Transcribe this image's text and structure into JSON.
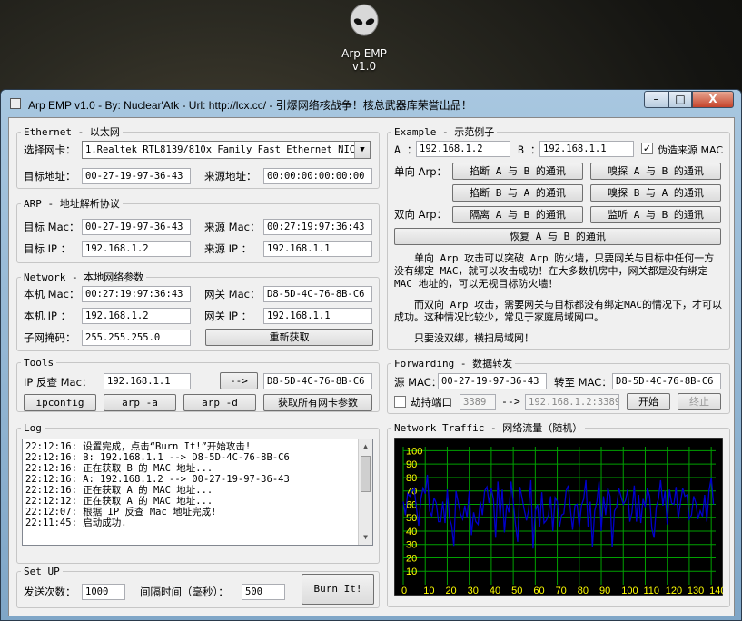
{
  "desktop_icon": {
    "name": "Arp EMP",
    "version": "v1.0"
  },
  "window": {
    "title": "Arp EMP v1.0  -  By: Nuclear'Atk  -  Url: http://lcx.cc/  -  引爆网络核战争！核总武器库荣誉出品！",
    "controls": {
      "minimize": "–",
      "maximize": "□",
      "close": "X"
    }
  },
  "ethernet": {
    "legend": "Ethernet - 以太网",
    "nic_label": "选择网卡：",
    "nic_value": "1.Realtek RTL8139/810x Family Fast Ethernet NIC",
    "target_addr_label": "目标地址：",
    "target_addr": "00-27-19-97-36-43",
    "source_addr_label": "来源地址：",
    "source_addr": "00:00:00:00:00:00"
  },
  "arp": {
    "legend": "ARP - 地址解析协议",
    "target_mac_label": "目标 Mac：",
    "target_mac": "00-27-19-97-36-43",
    "source_mac_label": "来源 Mac：",
    "source_mac": "00:27:19:97:36:43",
    "target_ip_label": "目标 IP ：",
    "target_ip": "192.168.1.2",
    "source_ip_label": "来源 IP ：",
    "source_ip": "192.168.1.1"
  },
  "network": {
    "legend": "Network - 本地网络参数",
    "local_mac_label": "本机 Mac：",
    "local_mac": "00:27:19:97:36:43",
    "gateway_mac_label": "网关 Mac：",
    "gateway_mac": "D8-5D-4C-76-8B-C6",
    "local_ip_label": "本机 IP ：",
    "local_ip": "192.168.1.2",
    "gateway_ip_label": "网关 IP ：",
    "gateway_ip": "192.168.1.1",
    "subnet_label": "子网掩码：",
    "subnet": "255.255.255.0",
    "refresh_button": "重新获取"
  },
  "tools": {
    "legend": "Tools",
    "reverse_label": "IP 反查 Mac：",
    "reverse_ip": "192.168.1.1",
    "arrow_button": "-->",
    "reverse_result": "D8-5D-4C-76-8B-C6",
    "ipconfig_button": "ipconfig",
    "arp_a_button": "arp -a",
    "arp_d_button": "arp -d",
    "all_nic_button": "获取所有网卡参数"
  },
  "log": {
    "legend": "Log",
    "lines": [
      "22:12:16: 设置完成，点击“Burn It!”开始攻击!",
      "22:12:16: B: 192.168.1.1 --> D8-5D-4C-76-8B-C6",
      "22:12:16: 正在获取 B 的 MAC 地址...",
      "22:12:16: A: 192.168.1.2 --> 00-27-19-97-36-43",
      "22:12:16: 正在获取 A 的 MAC 地址...",
      "22:12:12: 正在获取 A 的 MAC 地址...",
      "22:12:07: 根据 IP 反查 Mac 地址完成!",
      "22:11:45: 启动成功."
    ]
  },
  "setup": {
    "legend": "Set UP",
    "count_label": "发送次数：",
    "count": "1000",
    "interval_label": "间隔时间（毫秒）：",
    "interval": "500",
    "burn_button": "Burn It!"
  },
  "example": {
    "legend": "Example - 示范例子",
    "a_label": "A ：",
    "a_value": "192.168.1.2",
    "b_label": "B ：",
    "b_value": "192.168.1.1",
    "spoof_label": "伪造来源 MAC",
    "spoof_checked": "✓",
    "one_way_label": "单向 Arp：",
    "two_way_label": "双向 Arp：",
    "buttons": {
      "cut_a_b": "掐断 A 与 B 的通讯",
      "sniff_a_b": "嗅探 A 与 B 的通讯",
      "cut_b_a": "掐断 B 与 A 的通讯",
      "sniff_b_a": "嗅探 B 与 A 的通讯",
      "isolate": "隔离 A 与 B 的通讯",
      "monitor": "监听 A 与 B 的通讯",
      "restore": "恢复 A 与 B 的通讯"
    },
    "desc": [
      "单向 Arp 攻击可以突破 Arp 防火墙，只要网关与目标中任何一方没有绑定 MAC，就可以攻击成功！在大多数机房中，网关都是没有绑定 MAC 地址的，可以无视目标防火墙！",
      "而双向 Arp 攻击，需要网关与目标都没有绑定MAC的情况下，才可以成功。这种情况比较少，常见于家庭局域网中。",
      "只要没双绑，横扫局域网！"
    ]
  },
  "forwarding": {
    "legend": "Forwarding - 数据转发",
    "src_label": "源 MAC：",
    "src_mac": "00-27-19-97-36-43",
    "to_label": "转至 MAC：",
    "to_mac": "D8-5D-4C-76-8B-C6",
    "hijack_label": "劫持端口",
    "port": "3389",
    "arrow": "-->",
    "dest": "192.168.1.2:3389",
    "start_button": "开始",
    "stop_button": "终止"
  },
  "traffic": {
    "legend": "Network Traffic - 网络流量（随机）",
    "line_color": "#0000cc",
    "grid_color": "#00a000",
    "label_color": "#ffff00"
  },
  "chart_data": {
    "type": "line",
    "x_ticks": [
      "0",
      "10",
      "20",
      "30",
      "40",
      "50",
      "60",
      "70",
      "80",
      "90",
      "100",
      "110",
      "120",
      "130",
      "140"
    ],
    "y_ticks": [
      "100",
      "90",
      "80",
      "70",
      "60",
      "50",
      "40",
      "30",
      "20",
      "10"
    ],
    "xlim": [
      0,
      142
    ],
    "ylim": [
      0,
      103
    ],
    "series": [
      {
        "values": [
          62,
          52,
          68,
          66,
          70,
          72,
          57,
          44,
          64,
          72,
          68,
          82,
          55,
          51,
          65,
          61,
          47,
          47,
          62,
          46,
          71,
          50,
          44,
          29,
          70,
          61,
          53,
          49,
          59,
          50,
          70,
          37,
          54,
          47,
          45,
          62,
          52,
          70,
          73,
          61,
          72,
          64,
          35,
          77,
          50,
          71,
          39,
          60,
          54,
          77,
          62,
          45,
          32,
          73,
          65,
          56,
          48,
          56,
          78,
          27,
          55,
          60,
          43,
          69,
          46,
          48,
          52,
          66,
          40,
          65,
          62,
          43,
          52,
          53,
          70,
          74,
          56,
          41,
          59,
          60,
          43,
          59,
          64,
          78,
          43,
          62,
          28,
          55,
          62,
          77,
          40,
          66,
          52,
          72,
          66,
          28,
          55,
          58,
          72,
          66,
          60,
          63,
          71,
          47,
          54,
          74,
          47,
          67,
          46,
          64,
          58,
          72,
          66,
          42,
          35,
          58,
          64,
          78,
          59,
          70,
          45,
          71,
          61,
          60,
          73,
          49,
          61,
          72,
          66,
          67,
          49,
          52,
          66,
          61,
          49,
          55,
          51,
          67,
          47,
          70,
          80,
          60
        ]
      }
    ]
  }
}
